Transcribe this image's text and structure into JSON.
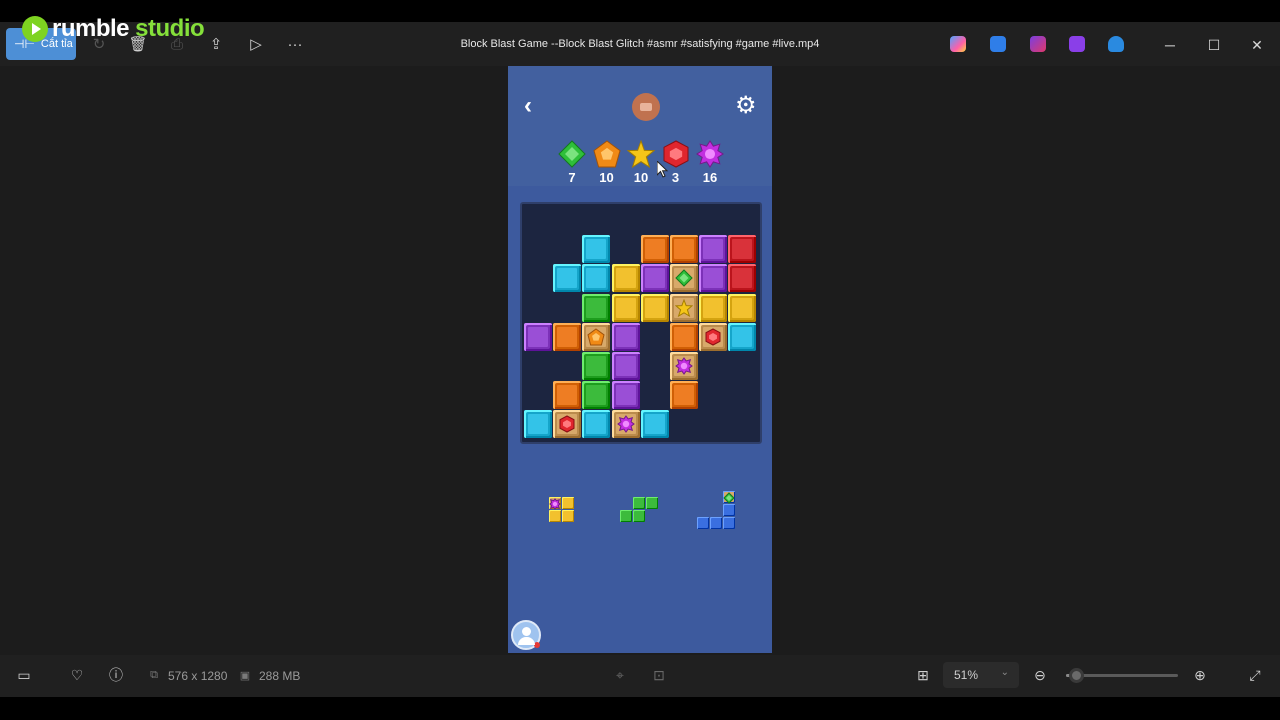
{
  "window": {
    "title": "Block Blast Game --Block Blast Glitch #asmr #satisfying #game #live.mp4"
  },
  "overlay_logo": {
    "part1": "rumble",
    "part2": " studio"
  },
  "toolbar": {
    "cut_label": "Cắt tỉa",
    "more_label": "···"
  },
  "window_controls": {
    "minimize": "─",
    "maximize": "☐",
    "close": "✕"
  },
  "game": {
    "goals": [
      {
        "gem": "green-diamond",
        "color": "#2fbf3a",
        "count": "7"
      },
      {
        "gem": "orange-pentagon",
        "color": "#f08a16",
        "count": "10"
      },
      {
        "gem": "yellow-star",
        "color": "#f5c518",
        "count": "10"
      },
      {
        "gem": "red-hexagon",
        "color": "#e0262e",
        "count": "3"
      },
      {
        "gem": "purple-burst",
        "color": "#c22ee0",
        "count": "16"
      }
    ],
    "board_cells": [
      {
        "r": 1,
        "c": 2,
        "color": "cyan"
      },
      {
        "r": 1,
        "c": 4,
        "color": "orange"
      },
      {
        "r": 1,
        "c": 5,
        "color": "orange"
      },
      {
        "r": 1,
        "c": 6,
        "color": "purple"
      },
      {
        "r": 1,
        "c": 7,
        "color": "red"
      },
      {
        "r": 2,
        "c": 1,
        "color": "cyan"
      },
      {
        "r": 2,
        "c": 2,
        "color": "cyan"
      },
      {
        "r": 2,
        "c": 3,
        "color": "yellow"
      },
      {
        "r": 2,
        "c": 4,
        "color": "purple"
      },
      {
        "r": 2,
        "c": 5,
        "color": "tan",
        "gem": "green-diamond"
      },
      {
        "r": 2,
        "c": 6,
        "color": "purple"
      },
      {
        "r": 2,
        "c": 7,
        "color": "red"
      },
      {
        "r": 3,
        "c": 2,
        "color": "green"
      },
      {
        "r": 3,
        "c": 3,
        "color": "yellow"
      },
      {
        "r": 3,
        "c": 4,
        "color": "yellow"
      },
      {
        "r": 3,
        "c": 5,
        "color": "tan",
        "gem": "yellow-star"
      },
      {
        "r": 3,
        "c": 6,
        "color": "yellow"
      },
      {
        "r": 3,
        "c": 7,
        "color": "yellow"
      },
      {
        "r": 4,
        "c": 0,
        "color": "purple"
      },
      {
        "r": 4,
        "c": 1,
        "color": "orange"
      },
      {
        "r": 4,
        "c": 2,
        "color": "tan",
        "gem": "orange-pentagon"
      },
      {
        "r": 4,
        "c": 3,
        "color": "purple"
      },
      {
        "r": 4,
        "c": 5,
        "color": "orange"
      },
      {
        "r": 4,
        "c": 6,
        "color": "tan",
        "gem": "red-hexagon"
      },
      {
        "r": 4,
        "c": 7,
        "color": "cyan"
      },
      {
        "r": 5,
        "c": 2,
        "color": "green"
      },
      {
        "r": 5,
        "c": 3,
        "color": "purple"
      },
      {
        "r": 5,
        "c": 5,
        "color": "tan",
        "gem": "purple-burst"
      },
      {
        "r": 6,
        "c": 1,
        "color": "orange"
      },
      {
        "r": 6,
        "c": 2,
        "color": "green"
      },
      {
        "r": 6,
        "c": 3,
        "color": "purple"
      },
      {
        "r": 6,
        "c": 5,
        "color": "orange"
      },
      {
        "r": 7,
        "c": 0,
        "color": "cyan"
      },
      {
        "r": 7,
        "c": 1,
        "color": "tan",
        "gem": "red-hexagon"
      },
      {
        "r": 7,
        "c": 2,
        "color": "cyan"
      },
      {
        "r": 7,
        "c": 3,
        "color": "tan",
        "gem": "purple-burst"
      },
      {
        "r": 7,
        "c": 4,
        "color": "cyan"
      }
    ],
    "block_colors": {
      "cyan": "#33c3e8",
      "orange": "#ee7d23",
      "purple": "#9a4fd6",
      "red": "#d9323a",
      "yellow": "#f2c12e",
      "green": "#3cbb3c",
      "tan": "#d8a96a",
      "blue": "#3a6fe0"
    },
    "next_pieces": [
      {
        "name": "yellow-square",
        "color": "yellow",
        "cells": [
          [
            0,
            0,
            "purple-burst"
          ],
          [
            0,
            1
          ],
          [
            1,
            0
          ],
          [
            1,
            1
          ]
        ]
      },
      {
        "name": "green-s",
        "color": "green",
        "cells": [
          [
            0,
            1
          ],
          [
            0,
            2
          ],
          [
            1,
            0
          ],
          [
            1,
            1
          ]
        ]
      },
      {
        "name": "blue-l",
        "color": "blue",
        "cells": [
          [
            0,
            2,
            "green-diamond"
          ],
          [
            1,
            2
          ],
          [
            2,
            0
          ],
          [
            2,
            1
          ],
          [
            2,
            2
          ]
        ]
      }
    ]
  },
  "status": {
    "dimensions": "576 x 1280",
    "file_size": "288 MB",
    "zoom": "51%",
    "zoom_fraction": 0.03
  }
}
